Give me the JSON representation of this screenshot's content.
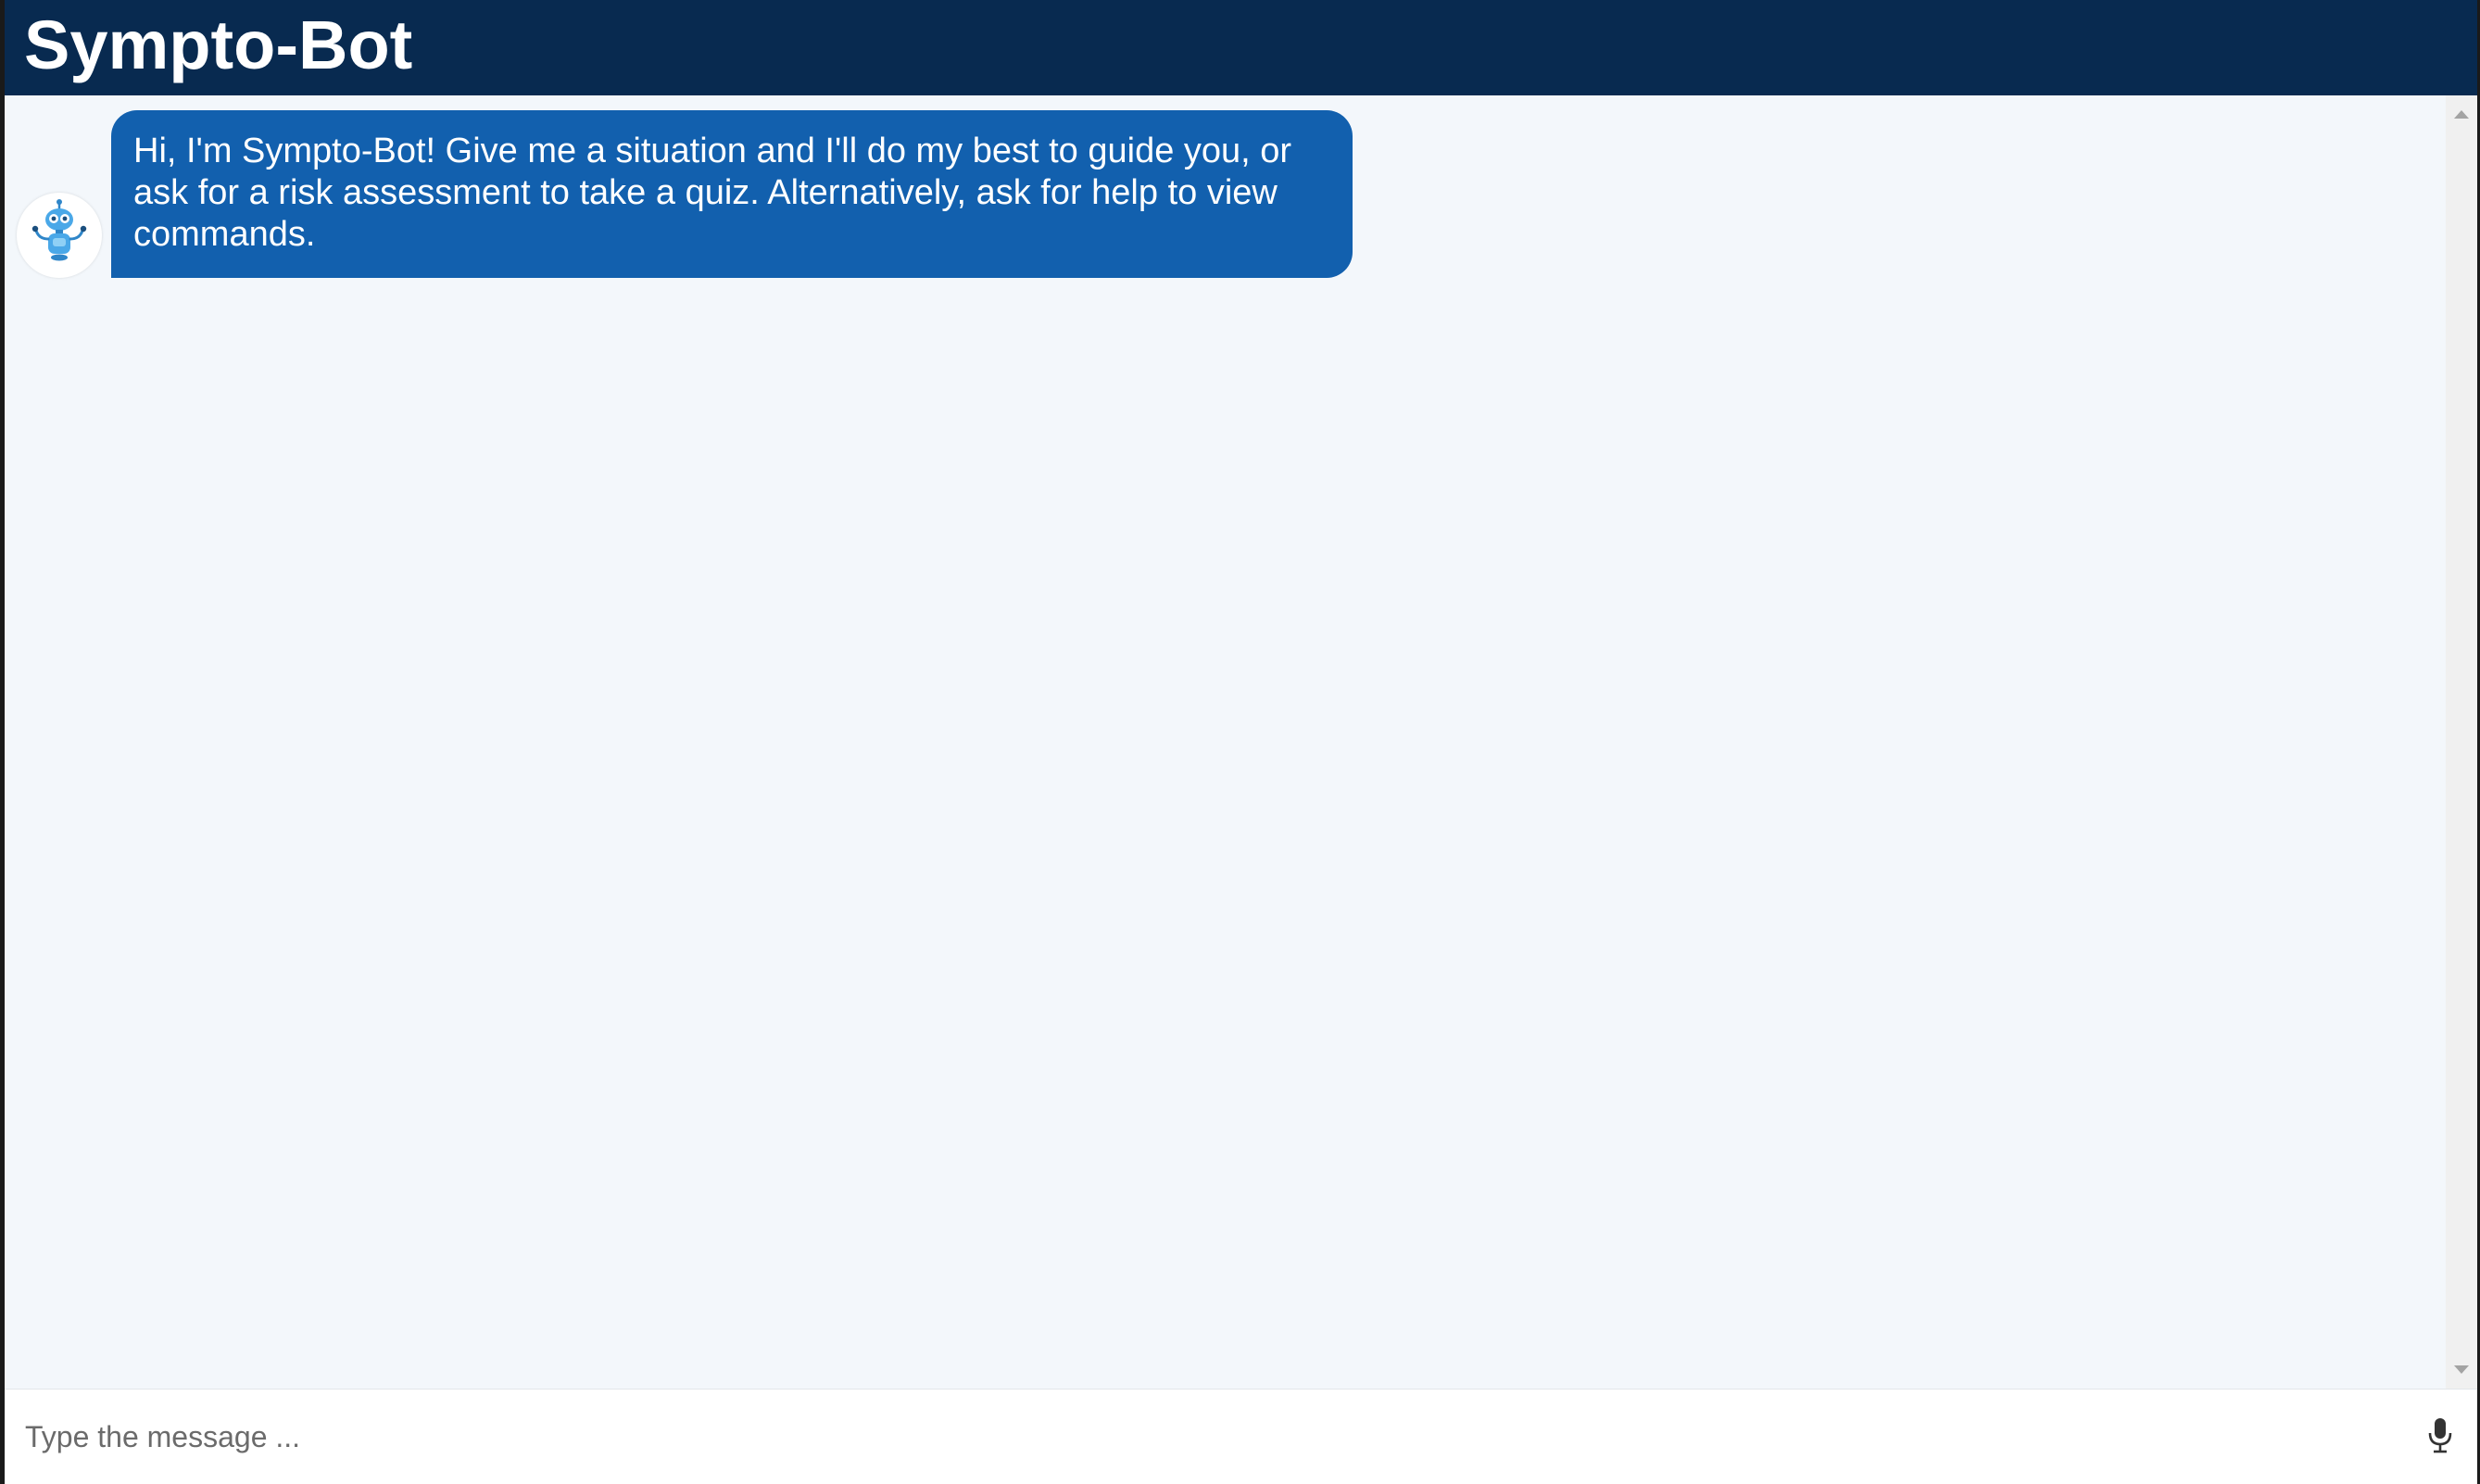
{
  "header": {
    "title": "Sympto-Bot"
  },
  "chat": {
    "messages": [
      {
        "sender": "bot",
        "avatar_icon": "robot-icon",
        "text": "Hi, I'm Sympto-Bot! Give me a situation and I'll do my best to guide you, or ask for a risk assessment to take a quiz. Alternatively, ask for help to view commands."
      }
    ]
  },
  "composer": {
    "placeholder": "Type the message ...",
    "value": "",
    "mic_icon": "microphone-icon"
  },
  "colors": {
    "header_bg": "#082a50",
    "bubble_bg": "#1260ae",
    "chat_bg": "#f3f7fb"
  }
}
